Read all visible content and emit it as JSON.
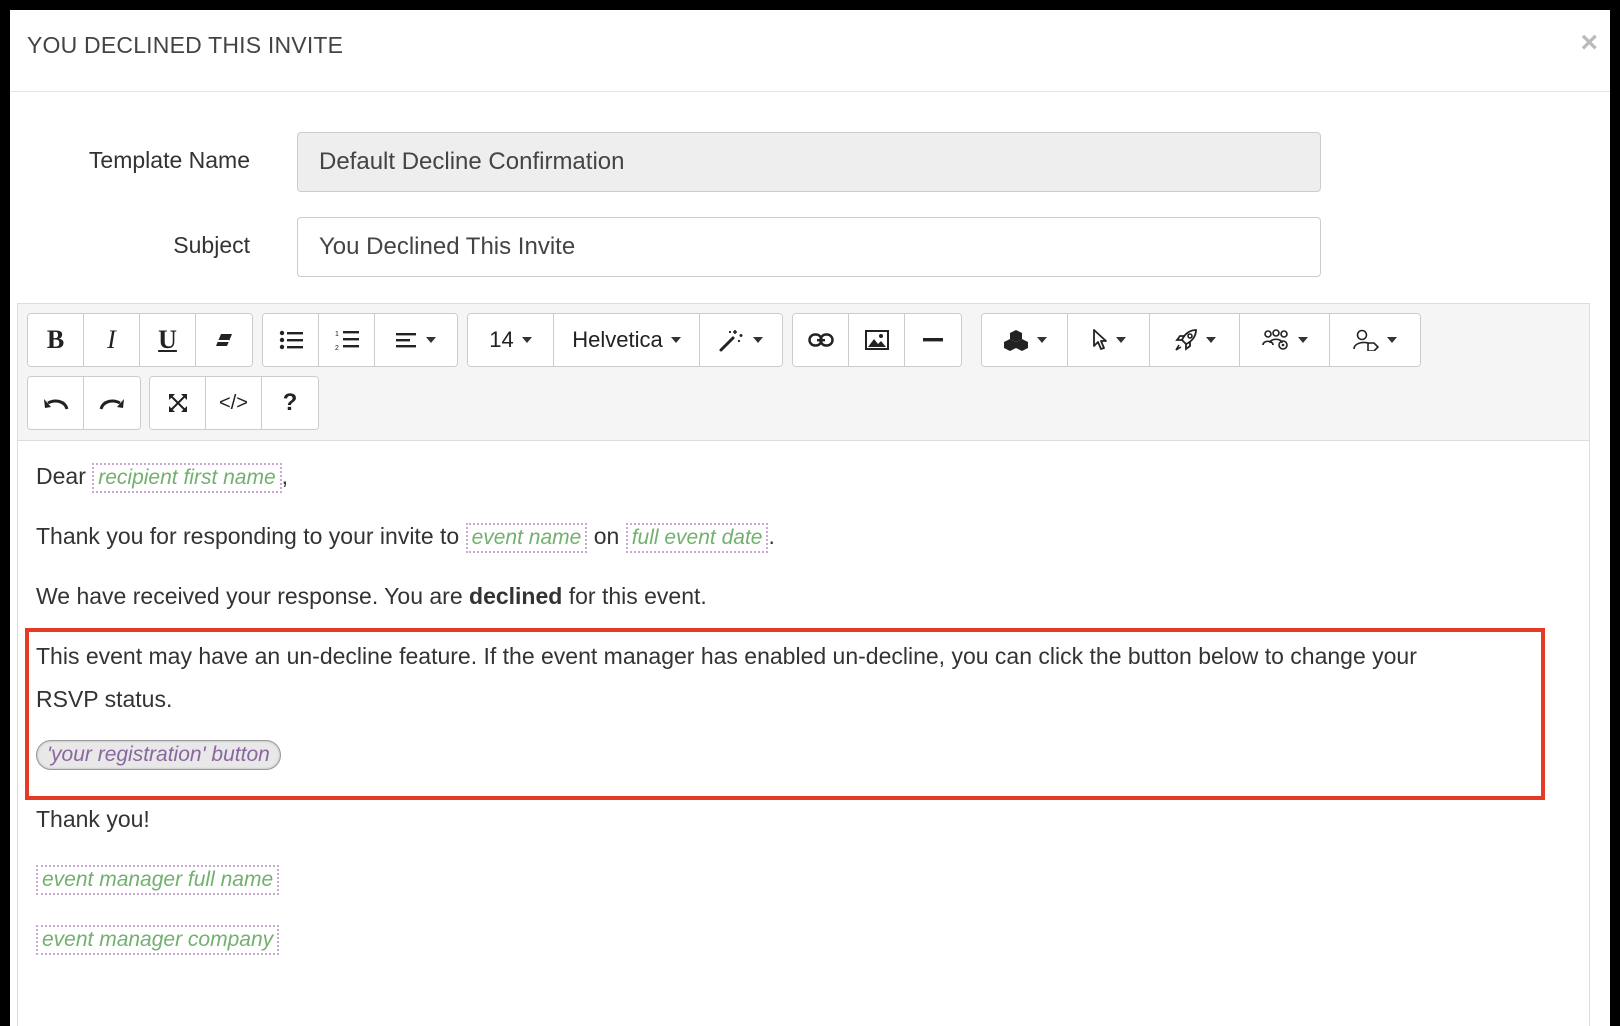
{
  "modal": {
    "title": "YOU DECLINED THIS INVITE",
    "close_glyph": "×"
  },
  "form": {
    "template_name_label": "Template Name",
    "template_name_value": "Default Decline Confirmation",
    "subject_label": "Subject",
    "subject_value": "You Declined This Invite"
  },
  "toolbar": {
    "bold": "B",
    "italic": "I",
    "underline": "U",
    "font_size": "14",
    "font_family": "Helvetica",
    "help": "?",
    "code": "</>"
  },
  "body": {
    "dear": "Dear",
    "recipient_tag": "recipient first name",
    "comma": ",",
    "thanks_prefix": "Thank you for responding to your invite to",
    "event_name_tag": "event name",
    "on": "on",
    "event_date_tag": "full event date",
    "period": ".",
    "received_prefix": "We have received your response. You are",
    "declined": "declined",
    "received_suffix": "for this event.",
    "undecline_line1": "This event may have an un-decline feature. If the event manager has enabled un-decline, you can click the button below to change your",
    "undecline_line2": "RSVP status.",
    "registration_button_tag": "'your registration' button",
    "thank_you": "Thank you!",
    "manager_name_tag": "event manager full name",
    "manager_company_tag": "event manager company"
  },
  "colors": {
    "highlight": "#e53b26",
    "tag_text": "#73b06f",
    "tag_border": "#c8a9d6"
  }
}
